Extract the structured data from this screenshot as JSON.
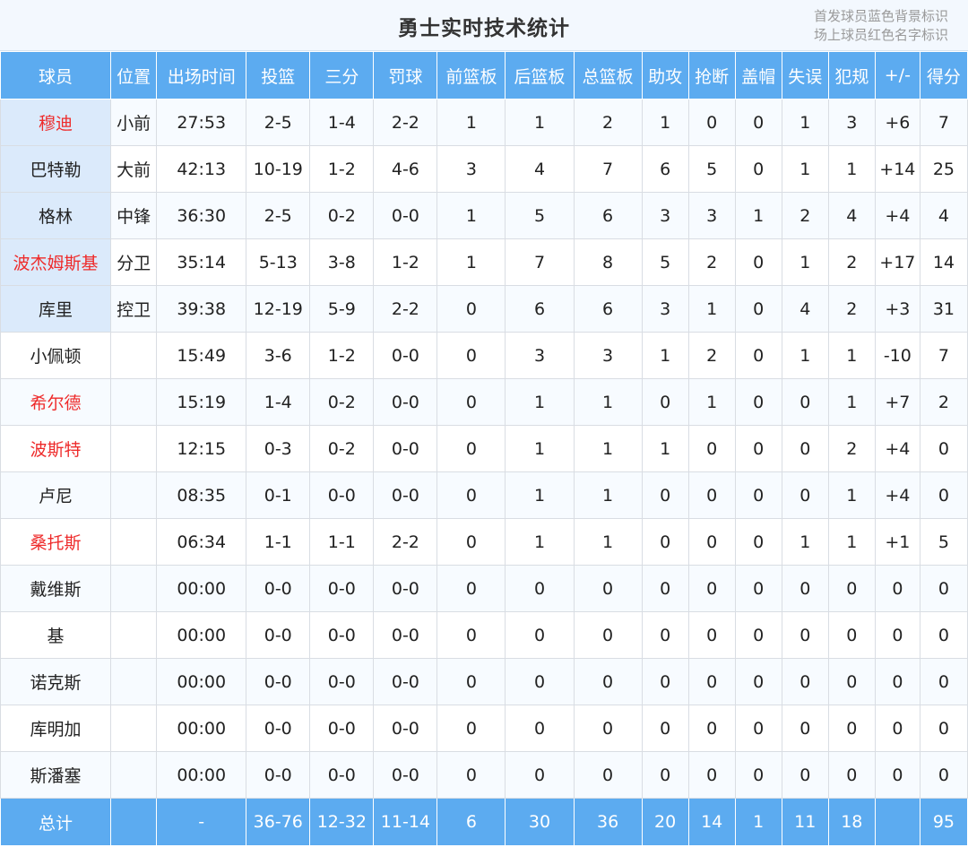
{
  "title": "勇士实时技术统计",
  "legend": {
    "starters_note": "首发球员蓝色背景标识",
    "on_court_note": "场上球员红色名字标识"
  },
  "colors": {
    "header_bg": "#5cabf0",
    "starter_bg": "#dbeafb",
    "on_court_text": "#ee2b2b"
  },
  "columns": [
    "球员",
    "位置",
    "出场时间",
    "投篮",
    "三分",
    "罚球",
    "前篮板",
    "后篮板",
    "总篮板",
    "助攻",
    "抢断",
    "盖帽",
    "失误",
    "犯规",
    "+/-",
    "得分"
  ],
  "players": [
    {
      "name": "穆迪",
      "pos": "小前",
      "min": "27:53",
      "fg": "2-5",
      "tp": "1-4",
      "ft": "2-2",
      "oreb": "1",
      "dreb": "1",
      "reb": "2",
      "ast": "1",
      "stl": "0",
      "blk": "0",
      "tov": "1",
      "pf": "3",
      "pm": "+6",
      "pts": "7",
      "starter": true,
      "on_court": true
    },
    {
      "name": "巴特勒",
      "pos": "大前",
      "min": "42:13",
      "fg": "10-19",
      "tp": "1-2",
      "ft": "4-6",
      "oreb": "3",
      "dreb": "4",
      "reb": "7",
      "ast": "6",
      "stl": "5",
      "blk": "0",
      "tov": "1",
      "pf": "1",
      "pm": "+14",
      "pts": "25",
      "starter": true,
      "on_court": false
    },
    {
      "name": "格林",
      "pos": "中锋",
      "min": "36:30",
      "fg": "2-5",
      "tp": "0-2",
      "ft": "0-0",
      "oreb": "1",
      "dreb": "5",
      "reb": "6",
      "ast": "3",
      "stl": "3",
      "blk": "1",
      "tov": "2",
      "pf": "4",
      "pm": "+4",
      "pts": "4",
      "starter": true,
      "on_court": false
    },
    {
      "name": "波杰姆斯基",
      "pos": "分卫",
      "min": "35:14",
      "fg": "5-13",
      "tp": "3-8",
      "ft": "1-2",
      "oreb": "1",
      "dreb": "7",
      "reb": "8",
      "ast": "5",
      "stl": "2",
      "blk": "0",
      "tov": "1",
      "pf": "2",
      "pm": "+17",
      "pts": "14",
      "starter": true,
      "on_court": true
    },
    {
      "name": "库里",
      "pos": "控卫",
      "min": "39:38",
      "fg": "12-19",
      "tp": "5-9",
      "ft": "2-2",
      "oreb": "0",
      "dreb": "6",
      "reb": "6",
      "ast": "3",
      "stl": "1",
      "blk": "0",
      "tov": "4",
      "pf": "2",
      "pm": "+3",
      "pts": "31",
      "starter": true,
      "on_court": false
    },
    {
      "name": "小佩顿",
      "pos": "",
      "min": "15:49",
      "fg": "3-6",
      "tp": "1-2",
      "ft": "0-0",
      "oreb": "0",
      "dreb": "3",
      "reb": "3",
      "ast": "1",
      "stl": "2",
      "blk": "0",
      "tov": "1",
      "pf": "1",
      "pm": "-10",
      "pts": "7",
      "starter": false,
      "on_court": false
    },
    {
      "name": "希尔德",
      "pos": "",
      "min": "15:19",
      "fg": "1-4",
      "tp": "0-2",
      "ft": "0-0",
      "oreb": "0",
      "dreb": "1",
      "reb": "1",
      "ast": "0",
      "stl": "1",
      "blk": "0",
      "tov": "0",
      "pf": "1",
      "pm": "+7",
      "pts": "2",
      "starter": false,
      "on_court": true
    },
    {
      "name": "波斯特",
      "pos": "",
      "min": "12:15",
      "fg": "0-3",
      "tp": "0-2",
      "ft": "0-0",
      "oreb": "0",
      "dreb": "1",
      "reb": "1",
      "ast": "1",
      "stl": "0",
      "blk": "0",
      "tov": "0",
      "pf": "2",
      "pm": "+4",
      "pts": "0",
      "starter": false,
      "on_court": true
    },
    {
      "name": "卢尼",
      "pos": "",
      "min": "08:35",
      "fg": "0-1",
      "tp": "0-0",
      "ft": "0-0",
      "oreb": "0",
      "dreb": "1",
      "reb": "1",
      "ast": "0",
      "stl": "0",
      "blk": "0",
      "tov": "0",
      "pf": "1",
      "pm": "+4",
      "pts": "0",
      "starter": false,
      "on_court": false
    },
    {
      "name": "桑托斯",
      "pos": "",
      "min": "06:34",
      "fg": "1-1",
      "tp": "1-1",
      "ft": "2-2",
      "oreb": "0",
      "dreb": "1",
      "reb": "1",
      "ast": "0",
      "stl": "0",
      "blk": "0",
      "tov": "1",
      "pf": "1",
      "pm": "+1",
      "pts": "5",
      "starter": false,
      "on_court": true
    },
    {
      "name": "戴维斯",
      "pos": "",
      "min": "00:00",
      "fg": "0-0",
      "tp": "0-0",
      "ft": "0-0",
      "oreb": "0",
      "dreb": "0",
      "reb": "0",
      "ast": "0",
      "stl": "0",
      "blk": "0",
      "tov": "0",
      "pf": "0",
      "pm": "0",
      "pts": "0",
      "starter": false,
      "on_court": false
    },
    {
      "name": "基",
      "pos": "",
      "min": "00:00",
      "fg": "0-0",
      "tp": "0-0",
      "ft": "0-0",
      "oreb": "0",
      "dreb": "0",
      "reb": "0",
      "ast": "0",
      "stl": "0",
      "blk": "0",
      "tov": "0",
      "pf": "0",
      "pm": "0",
      "pts": "0",
      "starter": false,
      "on_court": false
    },
    {
      "name": "诺克斯",
      "pos": "",
      "min": "00:00",
      "fg": "0-0",
      "tp": "0-0",
      "ft": "0-0",
      "oreb": "0",
      "dreb": "0",
      "reb": "0",
      "ast": "0",
      "stl": "0",
      "blk": "0",
      "tov": "0",
      "pf": "0",
      "pm": "0",
      "pts": "0",
      "starter": false,
      "on_court": false
    },
    {
      "name": "库明加",
      "pos": "",
      "min": "00:00",
      "fg": "0-0",
      "tp": "0-0",
      "ft": "0-0",
      "oreb": "0",
      "dreb": "0",
      "reb": "0",
      "ast": "0",
      "stl": "0",
      "blk": "0",
      "tov": "0",
      "pf": "0",
      "pm": "0",
      "pts": "0",
      "starter": false,
      "on_court": false
    },
    {
      "name": "斯潘塞",
      "pos": "",
      "min": "00:00",
      "fg": "0-0",
      "tp": "0-0",
      "ft": "0-0",
      "oreb": "0",
      "dreb": "0",
      "reb": "0",
      "ast": "0",
      "stl": "0",
      "blk": "0",
      "tov": "0",
      "pf": "0",
      "pm": "0",
      "pts": "0",
      "starter": false,
      "on_court": false
    }
  ],
  "totals": {
    "label": "总计",
    "pos": "",
    "min": "-",
    "fg": "36-76",
    "tp": "12-32",
    "ft": "11-14",
    "oreb": "6",
    "dreb": "30",
    "reb": "36",
    "ast": "20",
    "stl": "14",
    "blk": "1",
    "tov": "11",
    "pf": "18",
    "pm": "",
    "pts": "95"
  }
}
